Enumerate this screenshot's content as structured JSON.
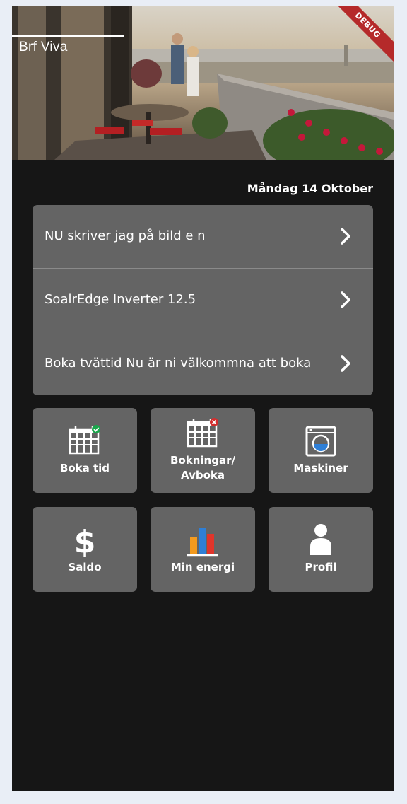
{
  "header": {
    "brand": "Brf Viva",
    "debug_banner": "DEBUG"
  },
  "date": "Måndag 14 Oktober",
  "news": [
    {
      "text": "NU skriver jag på bild e n"
    },
    {
      "text": "SoalrEdge Inverter 12.5"
    },
    {
      "text": "Boka tvättid Nu är ni välkommna att boka"
    }
  ],
  "tiles": [
    {
      "label": "Boka tid",
      "icon": "calendar-check-icon"
    },
    {
      "label": "Bokningar/ Avboka",
      "icon": "calendar-cancel-icon"
    },
    {
      "label": "Maskiner",
      "icon": "washing-machine-icon"
    },
    {
      "label": "Saldo",
      "icon": "dollar-icon"
    },
    {
      "label": "Min energi",
      "icon": "bar-chart-icon"
    },
    {
      "label": "Profil",
      "icon": "profile-icon"
    }
  ],
  "colors": {
    "background": "#161616",
    "card": "#646464",
    "check_green": "#1aa64b",
    "cancel_red": "#d32f2f",
    "bar_orange": "#f39a1e",
    "bar_blue": "#2f7fd6",
    "bar_red": "#e0352b"
  }
}
